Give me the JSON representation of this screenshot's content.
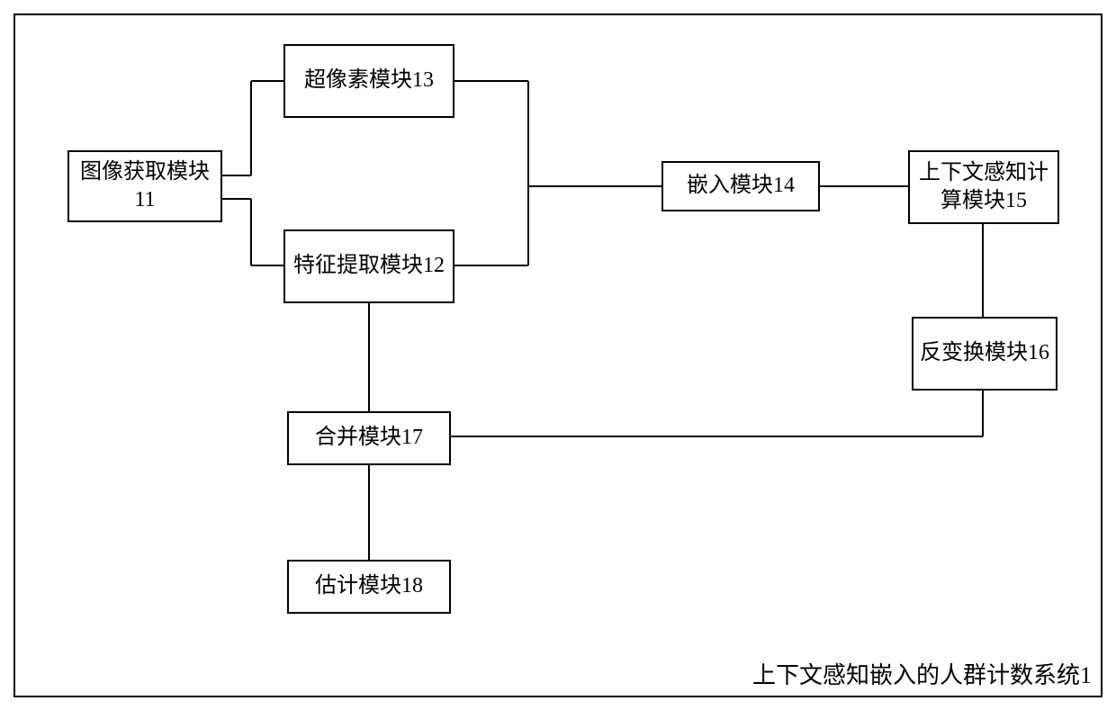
{
  "system_caption": "上下文感知嵌入的人群计数系统1",
  "modules": {
    "image_acquire": "图像获取模块11",
    "superpixel": "超像素模块13",
    "feature_extract": "特征提取模块12",
    "embed": "嵌入模块14",
    "context_aware": "上下文感知计算模块15",
    "inverse_transform": "反变换模块16",
    "merge": "合并模块17",
    "estimate": "估计模块18"
  }
}
